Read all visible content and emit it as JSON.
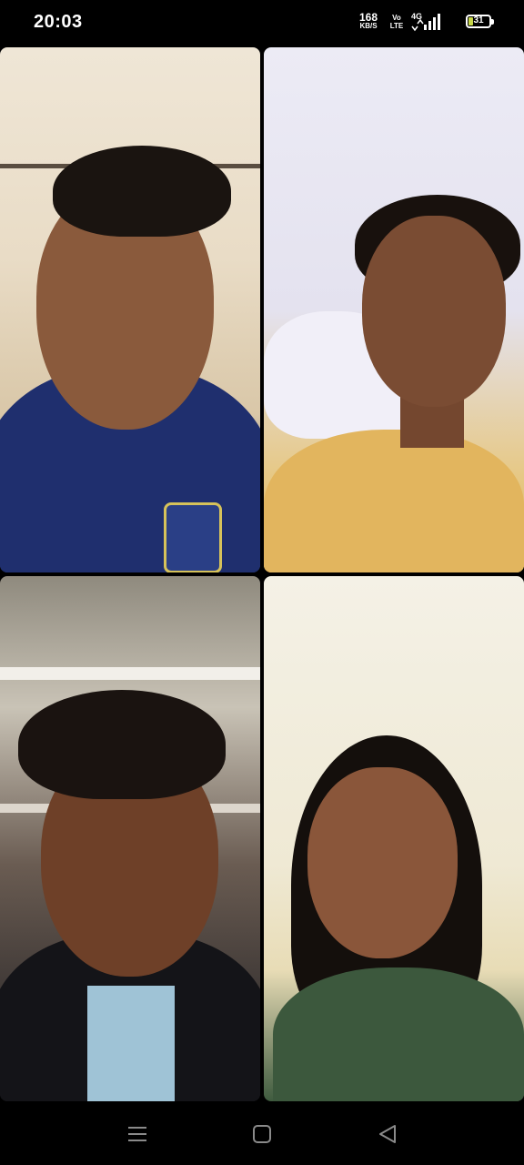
{
  "status_bar": {
    "time": "20:03",
    "network_speed_value": "168",
    "network_speed_unit": "KB/S",
    "volte_top": "Vo",
    "volte_bottom": "LTE",
    "network_type": "4G",
    "battery_level": "31",
    "battery_color": "#c8d84a"
  },
  "video_grid": {
    "tiles": [
      {
        "position": "top-left",
        "description_icon": "participant-video"
      },
      {
        "position": "top-right",
        "description_icon": "participant-video"
      },
      {
        "position": "bottom-left",
        "description_icon": "participant-video"
      },
      {
        "position": "bottom-right",
        "description_icon": "participant-video"
      }
    ]
  },
  "nav_bar": {
    "menu_icon": "menu-icon",
    "home_icon": "home-square-icon",
    "back_icon": "back-triangle-icon"
  }
}
